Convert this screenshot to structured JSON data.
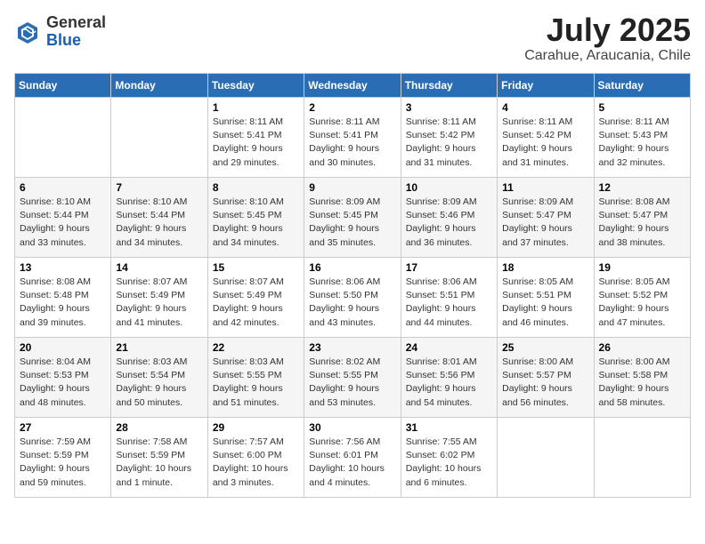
{
  "header": {
    "logo_line1": "General",
    "logo_line2": "Blue",
    "month": "July 2025",
    "location": "Carahue, Araucania, Chile"
  },
  "weekdays": [
    "Sunday",
    "Monday",
    "Tuesday",
    "Wednesday",
    "Thursday",
    "Friday",
    "Saturday"
  ],
  "weeks": [
    [
      {
        "day": "",
        "info": ""
      },
      {
        "day": "",
        "info": ""
      },
      {
        "day": "1",
        "info": "Sunrise: 8:11 AM\nSunset: 5:41 PM\nDaylight: 9 hours\nand 29 minutes."
      },
      {
        "day": "2",
        "info": "Sunrise: 8:11 AM\nSunset: 5:41 PM\nDaylight: 9 hours\nand 30 minutes."
      },
      {
        "day": "3",
        "info": "Sunrise: 8:11 AM\nSunset: 5:42 PM\nDaylight: 9 hours\nand 31 minutes."
      },
      {
        "day": "4",
        "info": "Sunrise: 8:11 AM\nSunset: 5:42 PM\nDaylight: 9 hours\nand 31 minutes."
      },
      {
        "day": "5",
        "info": "Sunrise: 8:11 AM\nSunset: 5:43 PM\nDaylight: 9 hours\nand 32 minutes."
      }
    ],
    [
      {
        "day": "6",
        "info": "Sunrise: 8:10 AM\nSunset: 5:44 PM\nDaylight: 9 hours\nand 33 minutes."
      },
      {
        "day": "7",
        "info": "Sunrise: 8:10 AM\nSunset: 5:44 PM\nDaylight: 9 hours\nand 34 minutes."
      },
      {
        "day": "8",
        "info": "Sunrise: 8:10 AM\nSunset: 5:45 PM\nDaylight: 9 hours\nand 34 minutes."
      },
      {
        "day": "9",
        "info": "Sunrise: 8:09 AM\nSunset: 5:45 PM\nDaylight: 9 hours\nand 35 minutes."
      },
      {
        "day": "10",
        "info": "Sunrise: 8:09 AM\nSunset: 5:46 PM\nDaylight: 9 hours\nand 36 minutes."
      },
      {
        "day": "11",
        "info": "Sunrise: 8:09 AM\nSunset: 5:47 PM\nDaylight: 9 hours\nand 37 minutes."
      },
      {
        "day": "12",
        "info": "Sunrise: 8:08 AM\nSunset: 5:47 PM\nDaylight: 9 hours\nand 38 minutes."
      }
    ],
    [
      {
        "day": "13",
        "info": "Sunrise: 8:08 AM\nSunset: 5:48 PM\nDaylight: 9 hours\nand 39 minutes."
      },
      {
        "day": "14",
        "info": "Sunrise: 8:07 AM\nSunset: 5:49 PM\nDaylight: 9 hours\nand 41 minutes."
      },
      {
        "day": "15",
        "info": "Sunrise: 8:07 AM\nSunset: 5:49 PM\nDaylight: 9 hours\nand 42 minutes."
      },
      {
        "day": "16",
        "info": "Sunrise: 8:06 AM\nSunset: 5:50 PM\nDaylight: 9 hours\nand 43 minutes."
      },
      {
        "day": "17",
        "info": "Sunrise: 8:06 AM\nSunset: 5:51 PM\nDaylight: 9 hours\nand 44 minutes."
      },
      {
        "day": "18",
        "info": "Sunrise: 8:05 AM\nSunset: 5:51 PM\nDaylight: 9 hours\nand 46 minutes."
      },
      {
        "day": "19",
        "info": "Sunrise: 8:05 AM\nSunset: 5:52 PM\nDaylight: 9 hours\nand 47 minutes."
      }
    ],
    [
      {
        "day": "20",
        "info": "Sunrise: 8:04 AM\nSunset: 5:53 PM\nDaylight: 9 hours\nand 48 minutes."
      },
      {
        "day": "21",
        "info": "Sunrise: 8:03 AM\nSunset: 5:54 PM\nDaylight: 9 hours\nand 50 minutes."
      },
      {
        "day": "22",
        "info": "Sunrise: 8:03 AM\nSunset: 5:55 PM\nDaylight: 9 hours\nand 51 minutes."
      },
      {
        "day": "23",
        "info": "Sunrise: 8:02 AM\nSunset: 5:55 PM\nDaylight: 9 hours\nand 53 minutes."
      },
      {
        "day": "24",
        "info": "Sunrise: 8:01 AM\nSunset: 5:56 PM\nDaylight: 9 hours\nand 54 minutes."
      },
      {
        "day": "25",
        "info": "Sunrise: 8:00 AM\nSunset: 5:57 PM\nDaylight: 9 hours\nand 56 minutes."
      },
      {
        "day": "26",
        "info": "Sunrise: 8:00 AM\nSunset: 5:58 PM\nDaylight: 9 hours\nand 58 minutes."
      }
    ],
    [
      {
        "day": "27",
        "info": "Sunrise: 7:59 AM\nSunset: 5:59 PM\nDaylight: 9 hours\nand 59 minutes."
      },
      {
        "day": "28",
        "info": "Sunrise: 7:58 AM\nSunset: 5:59 PM\nDaylight: 10 hours\nand 1 minute."
      },
      {
        "day": "29",
        "info": "Sunrise: 7:57 AM\nSunset: 6:00 PM\nDaylight: 10 hours\nand 3 minutes."
      },
      {
        "day": "30",
        "info": "Sunrise: 7:56 AM\nSunset: 6:01 PM\nDaylight: 10 hours\nand 4 minutes."
      },
      {
        "day": "31",
        "info": "Sunrise: 7:55 AM\nSunset: 6:02 PM\nDaylight: 10 hours\nand 6 minutes."
      },
      {
        "day": "",
        "info": ""
      },
      {
        "day": "",
        "info": ""
      }
    ]
  ]
}
